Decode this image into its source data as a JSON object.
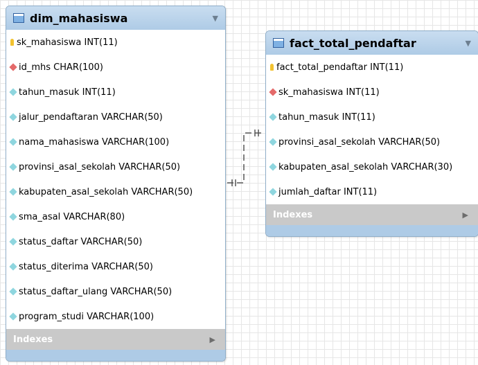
{
  "dim": {
    "title": "dim_mahasiswa",
    "columns": [
      {
        "text": "sk_mahasiswa INT(11)",
        "icon": "key"
      },
      {
        "text": "id_mhs CHAR(100)",
        "icon": "fk"
      },
      {
        "text": "tahun_masuk INT(11)",
        "icon": "diamond"
      },
      {
        "text": "jalur_pendaftaran VARCHAR(50)",
        "icon": "diamond"
      },
      {
        "text": "nama_mahasiswa VARCHAR(100)",
        "icon": "diamond"
      },
      {
        "text": "provinsi_asal_sekolah VARCHAR(50)",
        "icon": "diamond"
      },
      {
        "text": "kabupaten_asal_sekolah VARCHAR(50)",
        "icon": "diamond"
      },
      {
        "text": "sma_asal VARCHAR(80)",
        "icon": "diamond"
      },
      {
        "text": "status_daftar VARCHAR(50)",
        "icon": "diamond"
      },
      {
        "text": "status_diterima VARCHAR(50)",
        "icon": "diamond"
      },
      {
        "text": "status_daftar_ulang VARCHAR(50)",
        "icon": "diamond"
      },
      {
        "text": "program_studi VARCHAR(100)",
        "icon": "diamond"
      }
    ],
    "indexes_label": "Indexes"
  },
  "fact": {
    "title": "fact_total_pendaftar",
    "columns": [
      {
        "text": "fact_total_pendaftar INT(11)",
        "icon": "key"
      },
      {
        "text": "sk_mahasiswa INT(11)",
        "icon": "fk"
      },
      {
        "text": "tahun_masuk INT(11)",
        "icon": "diamond"
      },
      {
        "text": "provinsi_asal_sekolah VARCHAR(50)",
        "icon": "diamond"
      },
      {
        "text": "kabupaten_asal_sekolah VARCHAR(30)",
        "icon": "diamond"
      },
      {
        "text": "jumlah_daftar INT(11)",
        "icon": "diamond"
      }
    ],
    "indexes_label": "Indexes"
  },
  "colors": {
    "header": "#aecbe6",
    "indexes_bg": "#c9c9c9",
    "key": "#f2c230",
    "foreign_key": "#e46a6a",
    "column": "#8fd6df"
  }
}
